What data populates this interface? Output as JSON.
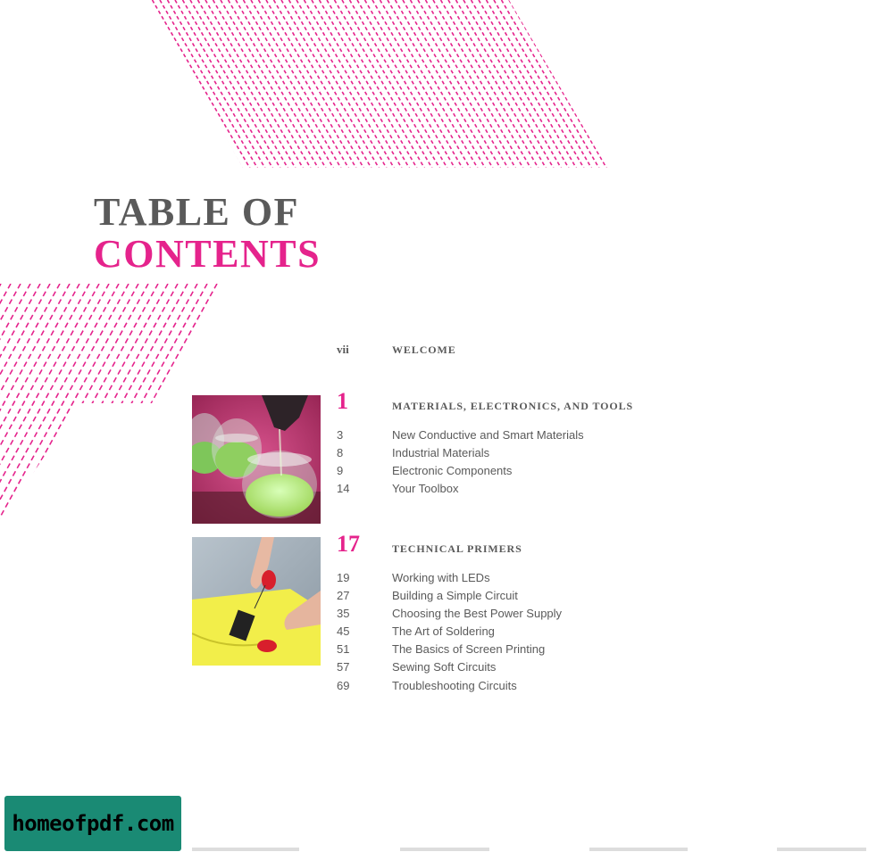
{
  "page": {
    "title_line1": "TABLE OF",
    "title_line2": "CONTENTS",
    "accent_color": "#e5238c",
    "text_color": "#5a5a5a"
  },
  "welcome": {
    "page": "vii",
    "heading": "WELCOME"
  },
  "chapters": [
    {
      "number": "1",
      "heading": "MATERIALS, ELECTRONICS, AND TOOLS",
      "image": "green-conductive-powder-jars-photo",
      "entries": [
        {
          "page": "3",
          "title": "New Conductive and Smart Materials"
        },
        {
          "page": "8",
          "title": "Industrial Materials"
        },
        {
          "page": "9",
          "title": "Electronic Components"
        },
        {
          "page": "14",
          "title": "Your Toolbox"
        }
      ]
    },
    {
      "number": "17",
      "heading": "TECHNICAL PRIMERS",
      "image": "hands-sewing-chip-on-fabric-photo",
      "entries": [
        {
          "page": "19",
          "title": "Working with LEDs"
        },
        {
          "page": "27",
          "title": "Building a Simple Circuit"
        },
        {
          "page": "35",
          "title": "Choosing the Best Power Supply"
        },
        {
          "page": "45",
          "title": "The Art of Soldering"
        },
        {
          "page": "51",
          "title": "The Basics of Screen Printing"
        },
        {
          "page": "57",
          "title": "Sewing Soft Circuits"
        },
        {
          "page": "69",
          "title": "Troubleshooting Circuits"
        }
      ]
    }
  ],
  "watermark": {
    "text": "homeofpdf.com"
  }
}
